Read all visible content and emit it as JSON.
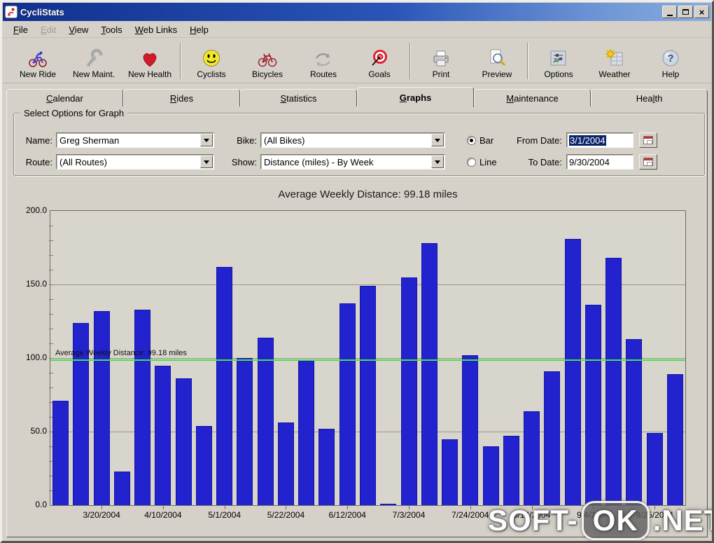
{
  "window": {
    "title": "CycliStats"
  },
  "menu": {
    "items": [
      {
        "label": "File",
        "enabled": true
      },
      {
        "label": "Edit",
        "enabled": false
      },
      {
        "label": "View",
        "enabled": true
      },
      {
        "label": "Tools",
        "enabled": true
      },
      {
        "label": "Web Links",
        "enabled": true
      },
      {
        "label": "Help",
        "enabled": true
      }
    ]
  },
  "toolbar": {
    "buttons": [
      "New Ride",
      "New Maint.",
      "New Health",
      "Cyclists",
      "Bicycles",
      "Routes",
      "Goals",
      "Print",
      "Preview",
      "Options",
      "Weather",
      "Help"
    ]
  },
  "tabs": {
    "items": [
      "Calendar",
      "Rides",
      "Statistics",
      "Graphs",
      "Maintenance",
      "Health"
    ],
    "active": "Graphs"
  },
  "options_panel": {
    "title": "Select Options for Graph",
    "name_label": "Name:",
    "name_value": "Greg Sherman",
    "route_label": "Route:",
    "route_value": "(All Routes)",
    "bike_label": "Bike:",
    "bike_value": "(All Bikes)",
    "show_label": "Show:",
    "show_value": "Distance (miles) - By Week",
    "bar_label": "Bar",
    "line_label": "Line",
    "selected_type": "Bar",
    "from_label": "From Date:",
    "from_value": "3/1/2004",
    "to_label": "To Date:",
    "to_value": "9/30/2004"
  },
  "chart_data": {
    "type": "bar",
    "title": "Average Weekly Distance: 99.18 miles",
    "xlabel": "",
    "ylabel": "",
    "ylim": [
      0,
      200
    ],
    "ytick_interval": 50,
    "minor_tick_interval": 10,
    "ytick_labels": [
      "0.0",
      "50.0",
      "100.0",
      "150.0",
      "200.0"
    ],
    "grid": true,
    "bar_color": "#2222cf",
    "values": [
      71,
      124,
      132,
      23,
      133,
      95,
      86,
      54,
      162,
      100,
      114,
      56,
      99,
      52,
      137,
      149,
      1,
      155,
      178,
      45,
      102,
      40,
      47,
      64,
      91,
      181,
      136,
      168,
      113,
      49,
      89
    ],
    "x_tick_labels": [
      "3/20/2004",
      "4/10/2004",
      "5/1/2004",
      "5/22/2004",
      "6/12/2004",
      "7/3/2004",
      "7/24/2004",
      "8/14/2004",
      "9/4/2004",
      "9/25/2004"
    ],
    "x_label_positions": [
      2,
      5,
      8,
      11,
      14,
      17,
      20,
      23,
      26,
      29
    ],
    "average_line": {
      "value": 99.18,
      "label": "Average Weekly Distance: 99.18 miles",
      "color": "#4be04b"
    }
  },
  "watermark": {
    "prefix": "SOFT-",
    "box": "OK",
    "suffix": ".NET"
  }
}
